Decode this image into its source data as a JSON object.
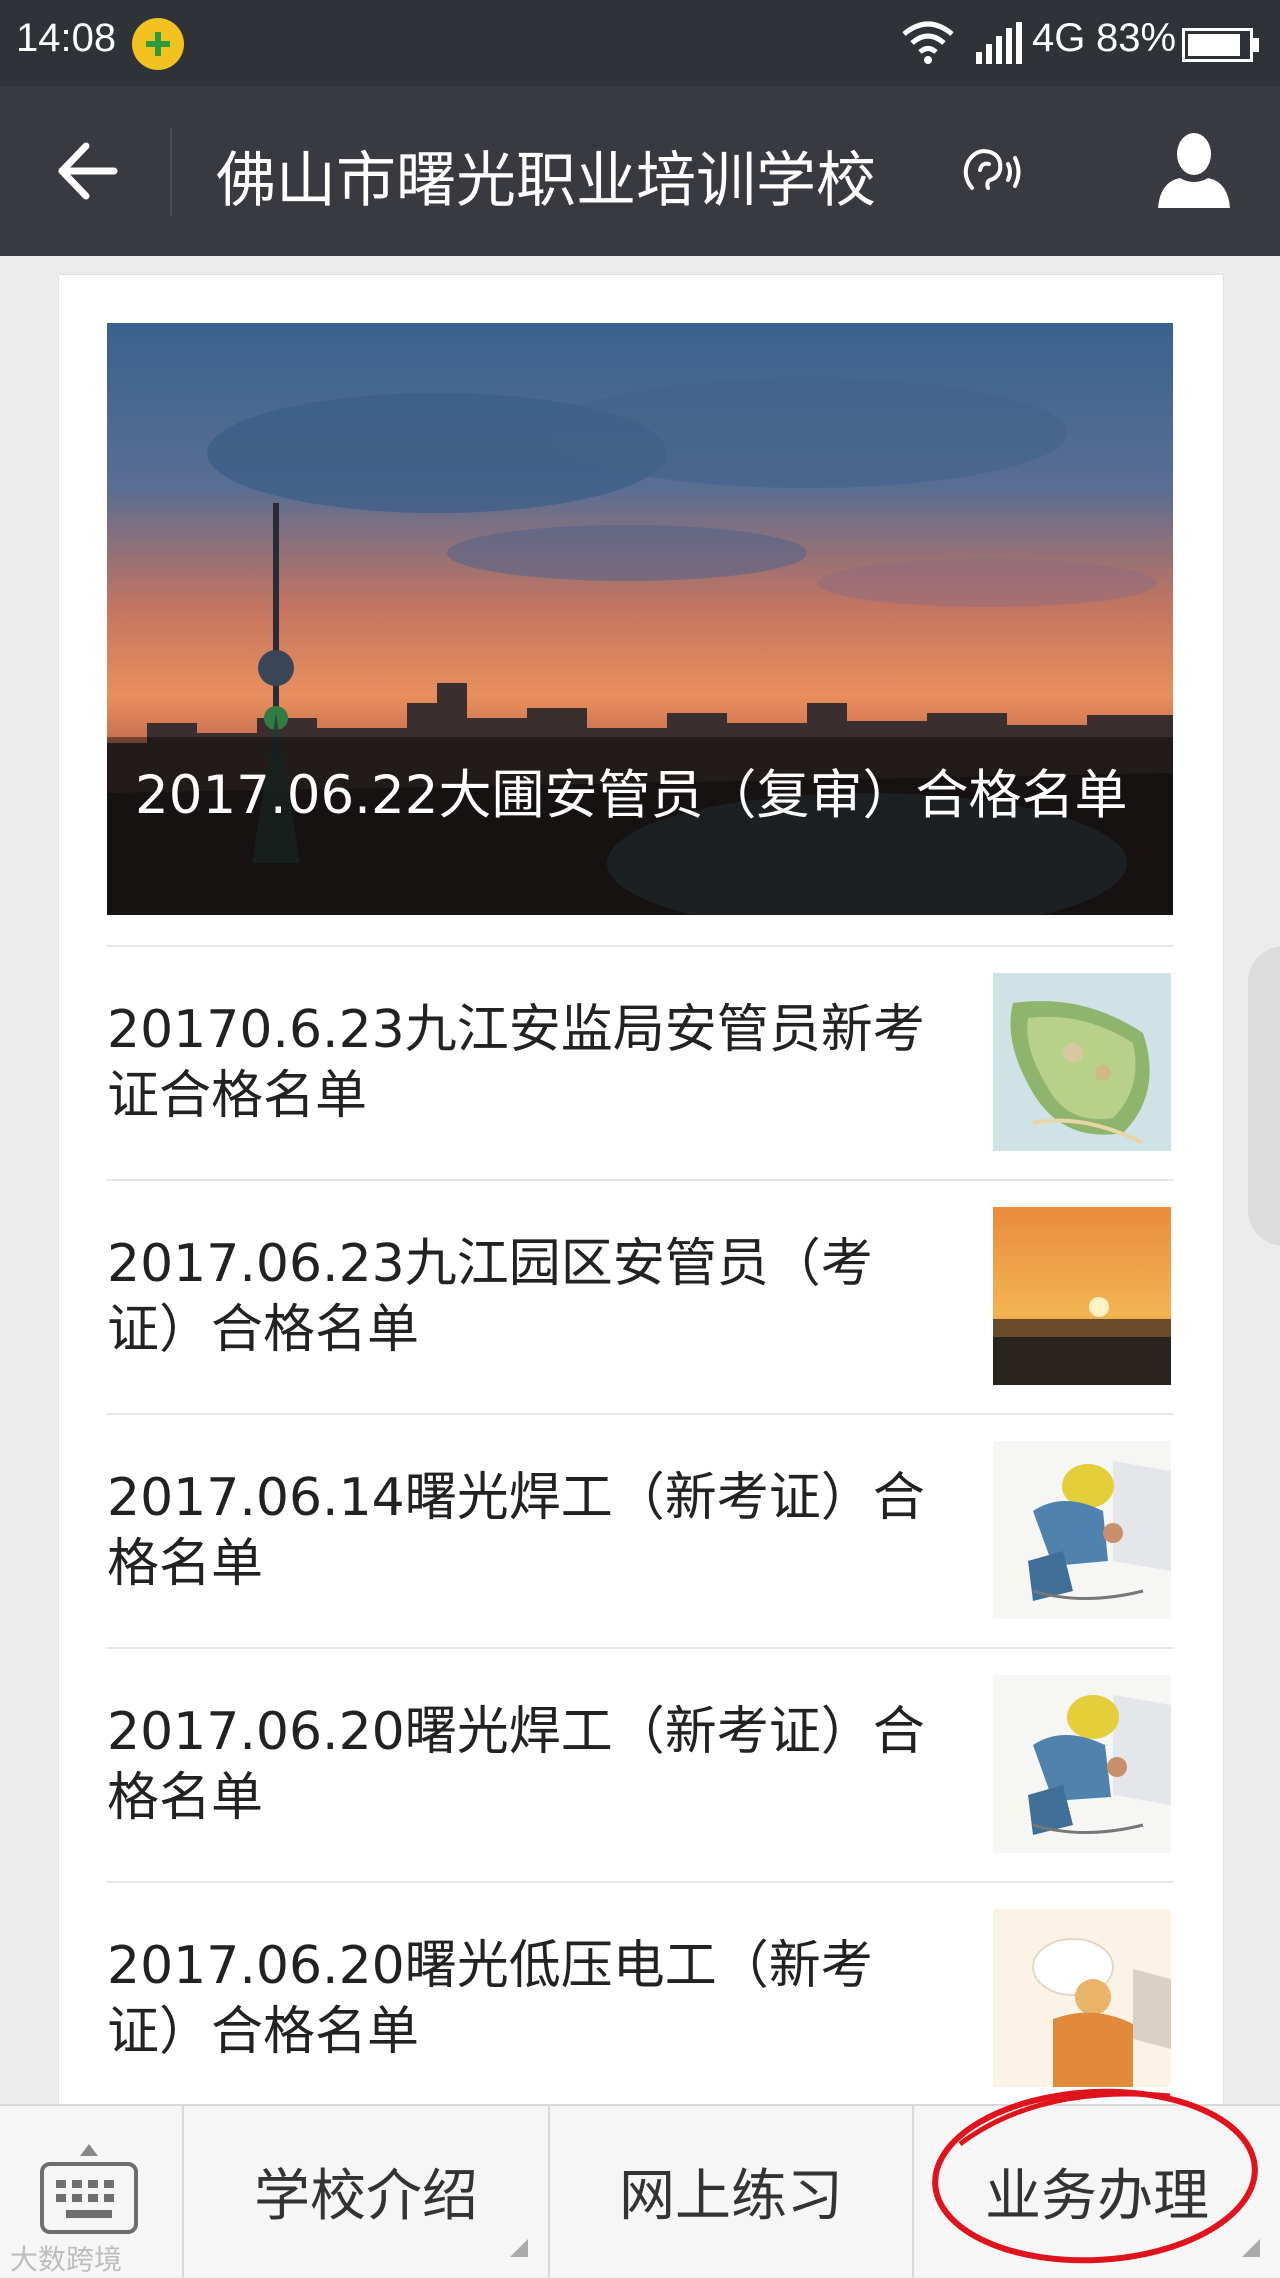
{
  "status_bar": {
    "time": "14:08",
    "network": "4G",
    "battery": "83%",
    "icons": [
      "qq-plus-icon",
      "wifi-icon",
      "signal-icon",
      "battery-icon"
    ]
  },
  "header": {
    "title": "佛山市曙光职业培训学校",
    "icons": [
      "back-arrow-icon",
      "ear-icon",
      "profile-icon"
    ],
    "color": "#393a3f"
  },
  "feed": {
    "featured": {
      "title": "2017.06.22大圃安管员（复审）合格名单",
      "image": "city-sunset-photo"
    },
    "items": [
      {
        "title": "20170.6.23九江安监局安管员新考证合格名单",
        "thumb": "park-aerial-thumb"
      },
      {
        "title": "2017.06.23九江园区安管员（考证）合格名单",
        "thumb": "sunset-lake-thumb"
      },
      {
        "title": "2017.06.14曙光焊工（新考证）合格名单",
        "thumb": "welder-cartoon-thumb"
      },
      {
        "title": "2017.06.20曙光焊工（新考证）合格名单",
        "thumb": "welder-cartoon-thumb"
      },
      {
        "title": "2017.06.20曙光低压电工（新考证）合格名单",
        "thumb": "electrician-cartoon-thumb"
      }
    ]
  },
  "bottom_menu": {
    "items": [
      "学校介绍",
      "网上练习",
      "业务办理"
    ],
    "annotation_color": "#e0121c"
  },
  "watermark": "大数跨境"
}
